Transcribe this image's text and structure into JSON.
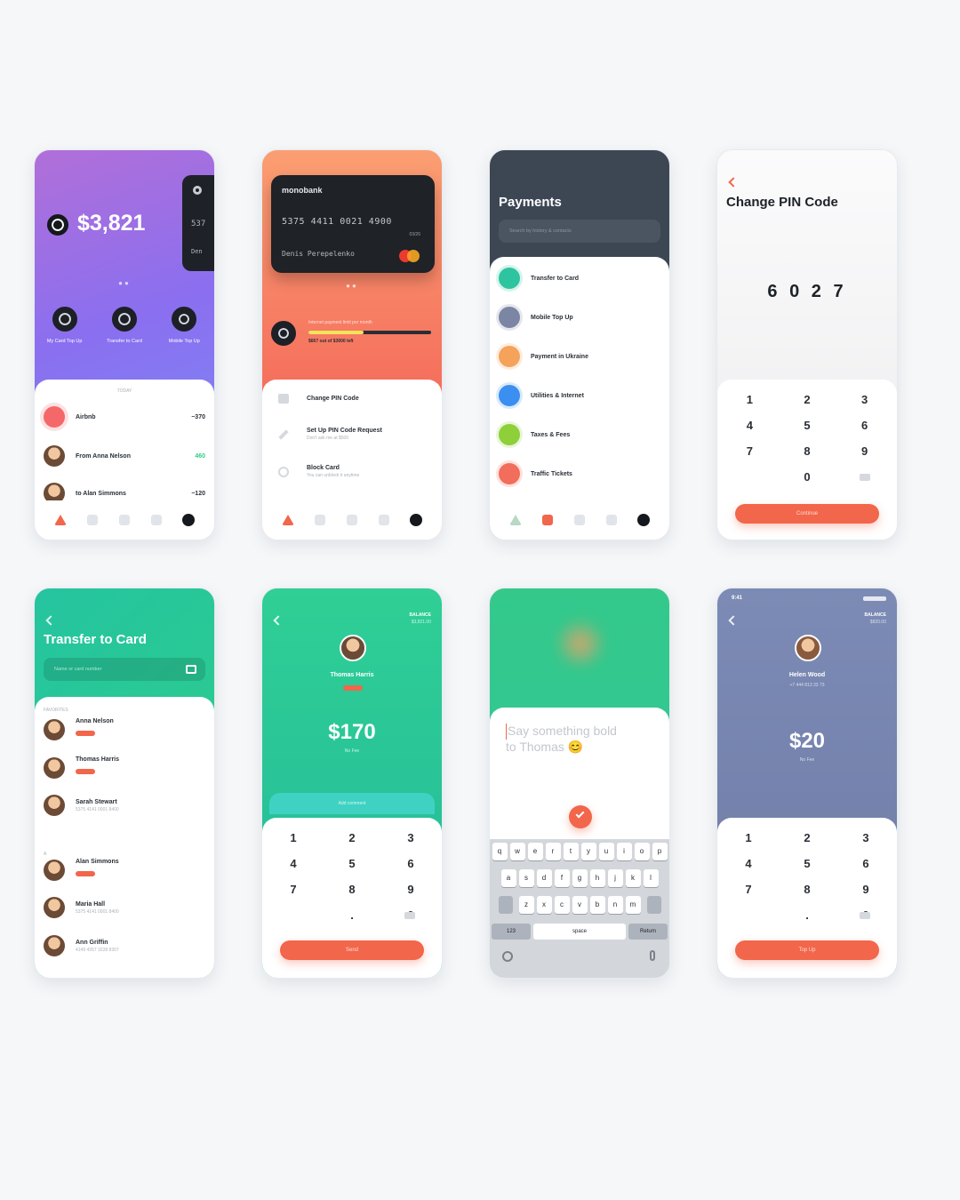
{
  "colors": {
    "accent": "#f2664b",
    "green": "#2fcf86",
    "slate": "#3d4753"
  },
  "s1": {
    "balance": "$3,821",
    "card_number_part": "537",
    "card_name_part": "Den",
    "actions": [
      {
        "icon": "card-icon",
        "label": "My Card Top Up"
      },
      {
        "icon": "transfer-icon",
        "label": "Transfer to Card"
      },
      {
        "icon": "mobile-icon",
        "label": "Mobile Top Up"
      }
    ],
    "section_label": "TODAY",
    "transactions": [
      {
        "name": "Airbnb",
        "amount": "−370",
        "type": "out"
      },
      {
        "name": "From Anna Nelson",
        "amount": "460",
        "type": "in"
      },
      {
        "name": "to Alan Simmons",
        "amount": "−120",
        "type": "out"
      }
    ]
  },
  "s2": {
    "bank": "monobank",
    "card_number": "5375 4411 0021 4900",
    "expiry": "03/26",
    "holder": "Denis Perepelenko",
    "limit_label": "Internet payment limit per month",
    "limit_value": "$667 out of $3000 left",
    "limit_fraction": 0.45,
    "settings": [
      {
        "title": "Change PIN Code",
        "sub": ""
      },
      {
        "title": "Set Up PIN Code Request",
        "sub": "Don't ask me at $500"
      },
      {
        "title": "Block Card",
        "sub": "You can unblock it anytime"
      }
    ]
  },
  "s3": {
    "title": "Payments",
    "search_placeholder": "Search by history & contacts",
    "items": [
      {
        "label": "Transfer to Card",
        "color": "#2ec4a0"
      },
      {
        "label": "Mobile Top Up",
        "color": "#7b86a4"
      },
      {
        "label": "Payment in Ukraine",
        "color": "#f5a25a"
      },
      {
        "label": "Utilities & Internet",
        "color": "#3a8ff0"
      },
      {
        "label": "Taxes & Fees",
        "color": "#8ecf3a"
      },
      {
        "label": "Traffic Tickets",
        "color": "#f26d5b"
      }
    ]
  },
  "s4": {
    "title": "Change PIN Code",
    "pin": "6 0 2 7",
    "confirm_label": "Continue"
  },
  "keys": [
    "1",
    "2",
    "3",
    "4",
    "5",
    "6",
    "7",
    "8",
    "9",
    "",
    ".",
    "0"
  ],
  "keys_pin": [
    "1",
    "2",
    "3",
    "4",
    "5",
    "6",
    "7",
    "8",
    "9",
    "",
    "0",
    ""
  ],
  "s5": {
    "title": "Transfer to Card",
    "search_placeholder": "Name or card number",
    "section_favorites": "FAVORITES",
    "contacts": [
      {
        "name": "Anna Nelson",
        "sub": ""
      },
      {
        "name": "Thomas Harris",
        "sub": ""
      },
      {
        "name": "Sarah Stewart",
        "sub": "5375 4141 0001 8400"
      },
      {
        "name": "Alan Simmons",
        "sub": ""
      },
      {
        "name": "Maria Hall",
        "sub": "5375 4141 0001 8400"
      },
      {
        "name": "Ann Griffin",
        "sub": "4149 4357 3228 8307"
      }
    ],
    "section_divider": "A"
  },
  "s6": {
    "balance_label": "BALANCE",
    "balance_value": "$3,821.00",
    "name": "Thomas Harris",
    "amount": "$170",
    "amount_caption": "No Fee",
    "comment_placeholder": "Add comment",
    "send_label": "Send"
  },
  "s7": {
    "message_line1": "Say something bold",
    "message_line2": "to Thomas 😊",
    "keyboard_rows": [
      [
        "q",
        "w",
        "e",
        "r",
        "t",
        "y",
        "u",
        "i",
        "o",
        "p"
      ],
      [
        "a",
        "s",
        "d",
        "f",
        "g",
        "h",
        "j",
        "k",
        "l"
      ],
      [
        "z",
        "x",
        "c",
        "v",
        "b",
        "n",
        "m"
      ]
    ],
    "key_123": "123",
    "key_space": "space",
    "key_return": "Return"
  },
  "s8": {
    "status_time": "9:41",
    "balance_label": "BALANCE",
    "balance_value": "$820.00",
    "name": "Helen Wood",
    "phone": "+7 444 813 33 73",
    "amount": "$20",
    "amount_caption": "No Fee",
    "topup_label": "Top Up"
  }
}
